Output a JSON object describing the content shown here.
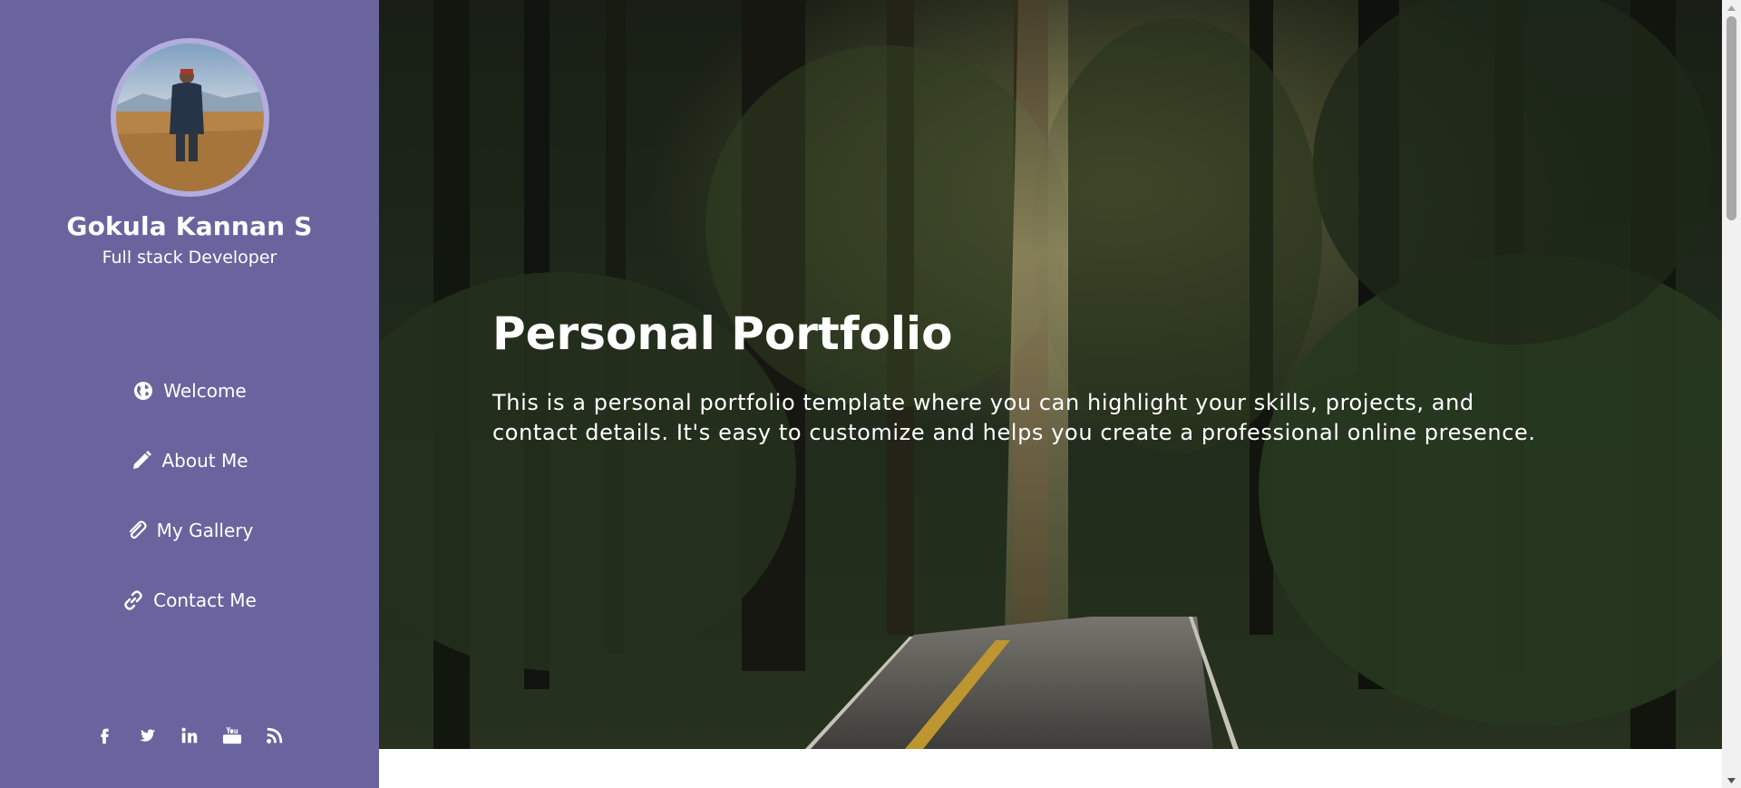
{
  "profile": {
    "name": "Gokula Kannan S",
    "role": "Full stack Developer"
  },
  "nav": [
    {
      "label": "Welcome",
      "icon": "globe-icon"
    },
    {
      "label": "About Me",
      "icon": "pencil-icon"
    },
    {
      "label": "My Gallery",
      "icon": "paperclip-icon"
    },
    {
      "label": "Contact Me",
      "icon": "link-icon"
    }
  ],
  "social": [
    "facebook-icon",
    "twitter-icon",
    "linkedin-icon",
    "youtube-icon",
    "rss-icon"
  ],
  "hero": {
    "title": "Personal Portfolio",
    "description": "This is a personal portfolio template where you can highlight your skills, projects, and contact details. It's easy to customize and helps you create a professional online presence."
  },
  "colors": {
    "sidebar": "#6a649e",
    "avatar_border": "#b3acdd",
    "text": "#ffffff"
  }
}
